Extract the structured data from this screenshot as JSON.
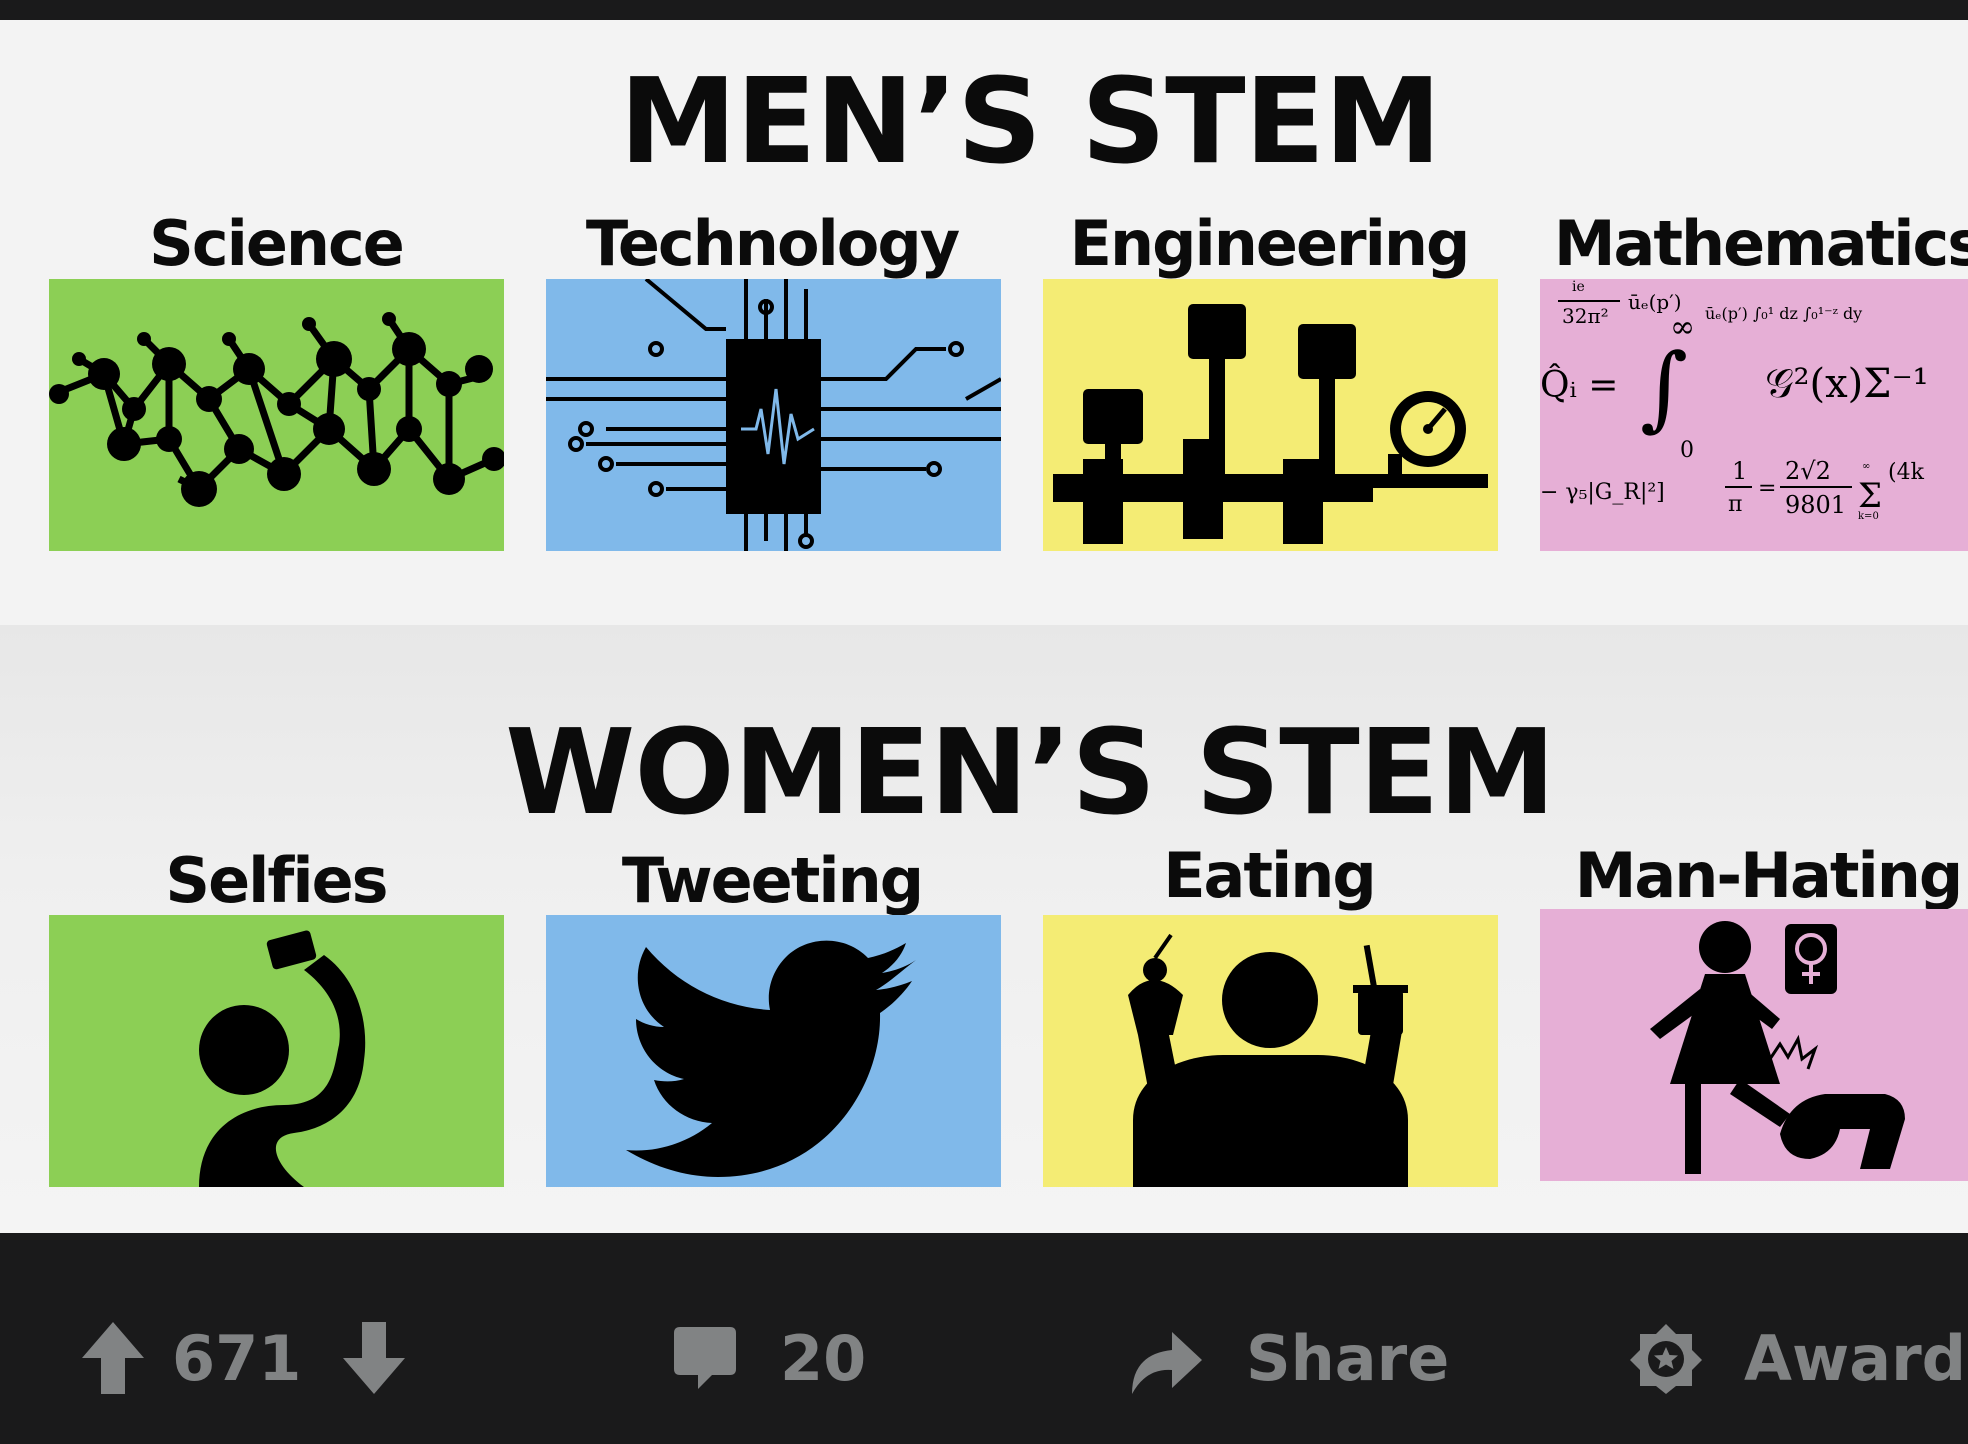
{
  "meme": {
    "men": {
      "title": "MEN’S STEM",
      "categories": [
        "Science",
        "Technology",
        "Engineering",
        "Mathematics"
      ]
    },
    "women": {
      "title": "WOMEN’S STEM",
      "categories": [
        "Selfies",
        "Tweeting",
        "Eating",
        "Man-Hating"
      ]
    },
    "colors": {
      "green": "#8ccf55",
      "blue": "#80b9ea",
      "yellow": "#f4ec74",
      "pink": "#e6afd6"
    },
    "icons": [
      "molecule-icon",
      "circuit-chip-icon",
      "engine-pistons-icon",
      "math-formula-icon",
      "selfie-person-icon",
      "twitter-bird-icon",
      "eating-person-icon",
      "kicking-person-icon"
    ],
    "math_snippets": {
      "a": "ie",
      "b": "32π²",
      "c": "ūₑ(p′)",
      "d": "Q̂ᵢ =",
      "e": "∫",
      "f": "∞",
      "g": "0",
      "h": "𝒢²(x)Σ⁻¹",
      "i": "ūₑ(p′) ∫₀¹ dz ∫₀¹⁻ᶻ dy",
      "j": "1",
      "k": "π",
      "l": "2√2",
      "m": "9801",
      "n": "Σ",
      "o": "(4k",
      "p": "− γ₅|G_R|²]",
      "q": "∞",
      "r": "k=0"
    }
  },
  "post_actions": {
    "upvote_count": "671",
    "comment_count": "20",
    "share_label": "Share",
    "award_label": "Award",
    "text_color": "#818384",
    "background": "#1a1a1b"
  }
}
